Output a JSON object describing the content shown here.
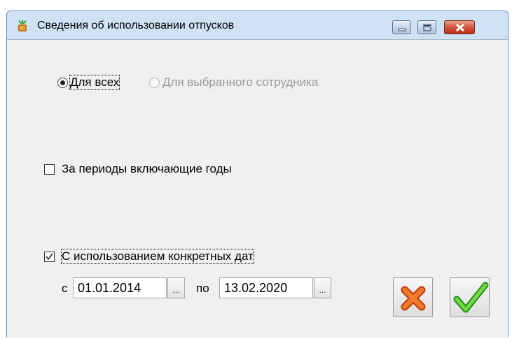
{
  "window": {
    "title": "Сведения об использовании отпусков",
    "icon": "app-icon"
  },
  "titlebar_buttons": {
    "minimize": "minimize-icon",
    "maximize": "maximize-icon",
    "close": "close-icon"
  },
  "scope": {
    "option_all": "Для всех",
    "option_selected": "Для выбранного сотрудника",
    "selected": "all"
  },
  "periods_checkbox": {
    "label": "За периоды включающие годы",
    "checked": false
  },
  "dates_checkbox": {
    "label": "С использованием конкретных дат",
    "checked": true
  },
  "date_range": {
    "from_label": "с",
    "from_value": "01.01.2014",
    "to_label": "по",
    "to_value": "13.02.2020",
    "picker_label": "..."
  },
  "actions": {
    "cancel_icon": "red-x-icon",
    "ok_icon": "green-check-icon"
  },
  "colors": {
    "cancel": "#e8641c",
    "ok": "#3ab41f",
    "titlebar": "#c4d9ef",
    "client_bg": "#f0f0f0"
  }
}
